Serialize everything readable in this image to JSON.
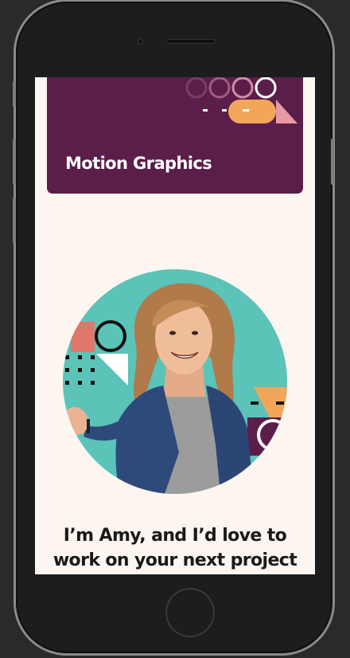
{
  "card": {
    "title": "Motion Graphics",
    "background_color": "#5b1e4a"
  },
  "hero": {
    "image_alt": "",
    "headline_line1": "I’m Amy, and I’d love to",
    "headline_line2": "work on your next project"
  },
  "colors": {
    "page_background": "#fdf5ef",
    "accent_teal": "#5bc3b8",
    "accent_orange": "#f2a65a",
    "accent_coral": "#e0776a",
    "accent_pink": "#e79aa5",
    "text_dark": "#1a1a1a"
  },
  "icons": [
    "ring-shape-icon",
    "pill-shape-icon",
    "triangle-shape-icon",
    "dot-grid-icon"
  ]
}
